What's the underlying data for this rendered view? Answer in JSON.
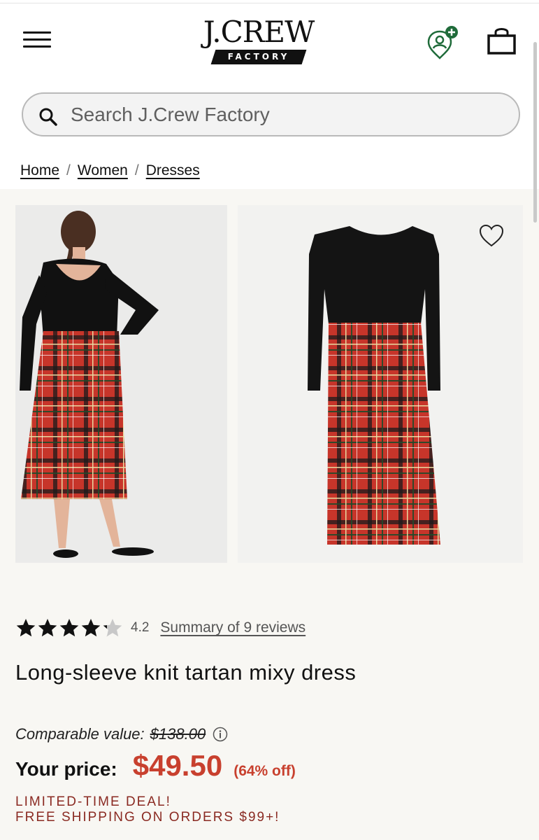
{
  "header": {
    "logo_main": "J.CREW",
    "logo_sub": "FACTORY"
  },
  "search": {
    "placeholder": "Search J.Crew Factory"
  },
  "breadcrumb": {
    "items": [
      "Home",
      "Women",
      "Dresses"
    ],
    "separator": "/"
  },
  "product": {
    "rating_value": 4.2,
    "rating_text": "4.2",
    "stars_max": 5,
    "reviews_link": "Summary of 9 reviews",
    "title": "Long-sleeve knit tartan mixy dress",
    "comparable_label": "Comparable value:",
    "comparable_price": "$138.00",
    "your_price_label": "Your price:",
    "price": "$49.50",
    "discount": "(64% off)",
    "deal_line1": "LIMITED-TIME DEAL!",
    "deal_line2": "FREE SHIPPING ON ORDERS $99+!"
  },
  "colors": {
    "price_red": "#c8402e",
    "deal_red": "#8a2a22",
    "tartan_red": "#c7352a",
    "location_green": "#1f6b3a",
    "page_bg": "#f8f7f3"
  },
  "icons": [
    "menu-icon",
    "location-plus-icon",
    "shopping-bag-icon",
    "search-icon",
    "heart-icon",
    "star-icon",
    "info-icon"
  ]
}
